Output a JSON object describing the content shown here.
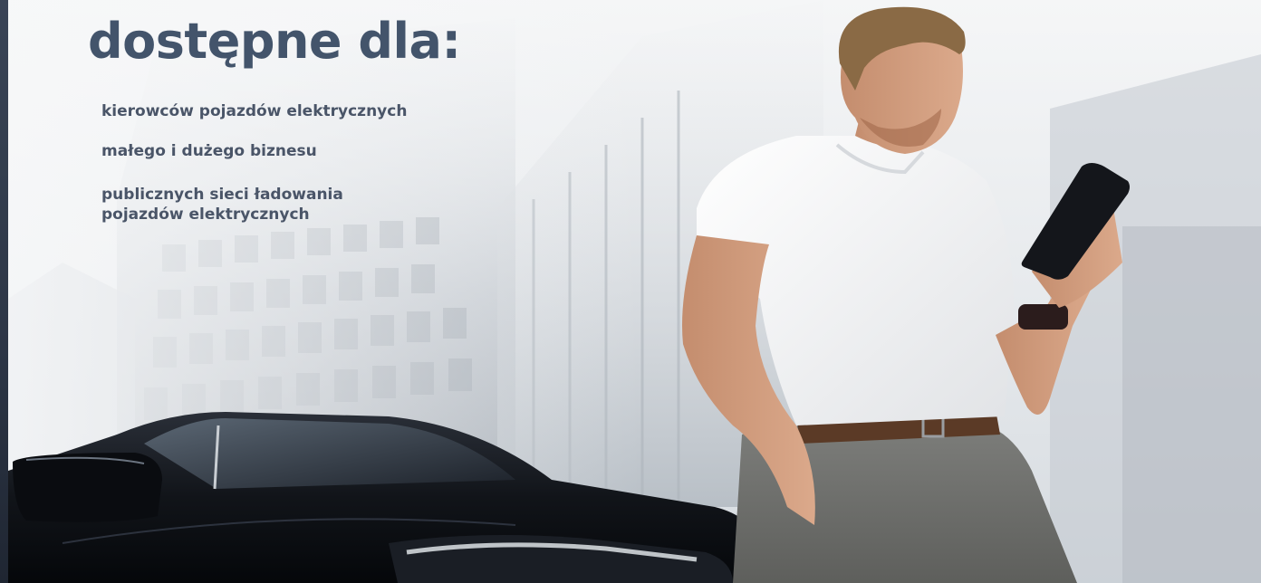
{
  "hero": {
    "heading": "dostępne dla:",
    "audience": [
      {
        "lines": [
          "kierowców pojazdów elektrycznych"
        ]
      },
      {
        "lines": [
          "małego i dużego biznesu"
        ]
      },
      {
        "lines": [
          "publicznych sieci ładowania",
          "pojazdów elektrycznych"
        ]
      }
    ],
    "photo": {
      "subject": "man-with-smartphone",
      "background": "office-buildings",
      "foreground": "black-electric-car"
    }
  },
  "colors": {
    "heading": "#43546b",
    "list_text": "#4a5568",
    "edge": "#2d3646"
  }
}
